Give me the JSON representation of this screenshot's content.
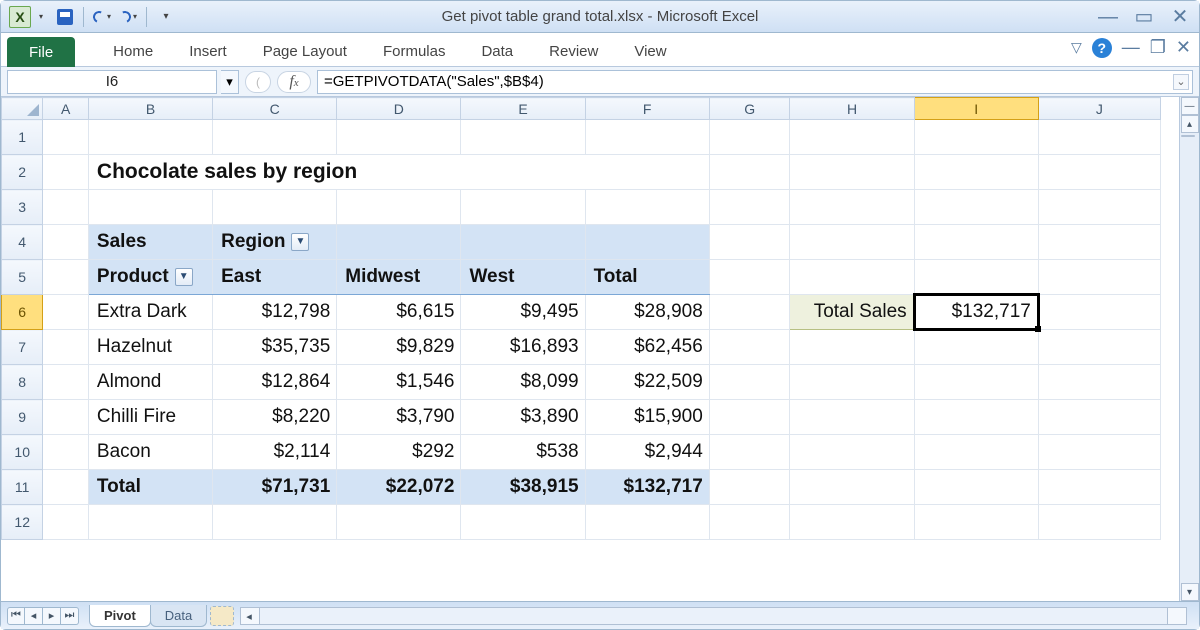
{
  "app": {
    "title_full": "Get pivot table grand total.xlsx  -  Microsoft Excel"
  },
  "ribbon": {
    "file": "File",
    "tabs": [
      "Home",
      "Insert",
      "Page Layout",
      "Formulas",
      "Data",
      "Review",
      "View"
    ]
  },
  "namebox": "I6",
  "formula": "=GETPIVOTDATA(\"Sales\",$B$4)",
  "columns": [
    "A",
    "B",
    "C",
    "D",
    "E",
    "F",
    "G",
    "H",
    "I",
    "J"
  ],
  "rows": [
    "1",
    "2",
    "3",
    "4",
    "5",
    "6",
    "7",
    "8",
    "9",
    "10",
    "11",
    "12"
  ],
  "selected_col": "I",
  "selected_row": "6",
  "heading": "Chocolate sales by region",
  "pivot": {
    "sales_label": "Sales",
    "region_label": "Region",
    "product_label": "Product",
    "col_headers": [
      "East",
      "Midwest",
      "West",
      "Total"
    ],
    "rows": [
      {
        "label": "Extra Dark",
        "vals": [
          "$12,798",
          "$6,615",
          "$9,495",
          "$28,908"
        ]
      },
      {
        "label": "Hazelnut",
        "vals": [
          "$35,735",
          "$9,829",
          "$16,893",
          "$62,456"
        ]
      },
      {
        "label": "Almond",
        "vals": [
          "$12,864",
          "$1,546",
          "$8,099",
          "$22,509"
        ]
      },
      {
        "label": "Chilli Fire",
        "vals": [
          "$8,220",
          "$3,790",
          "$3,890",
          "$15,900"
        ]
      },
      {
        "label": "Bacon",
        "vals": [
          "$2,114",
          "$292",
          "$538",
          "$2,944"
        ]
      }
    ],
    "total_label": "Total",
    "totals": [
      "$71,731",
      "$22,072",
      "$38,915",
      "$132,717"
    ]
  },
  "output": {
    "label": "Total Sales",
    "value": "$132,717"
  },
  "sheets": {
    "active": "Pivot",
    "others": [
      "Data"
    ]
  }
}
